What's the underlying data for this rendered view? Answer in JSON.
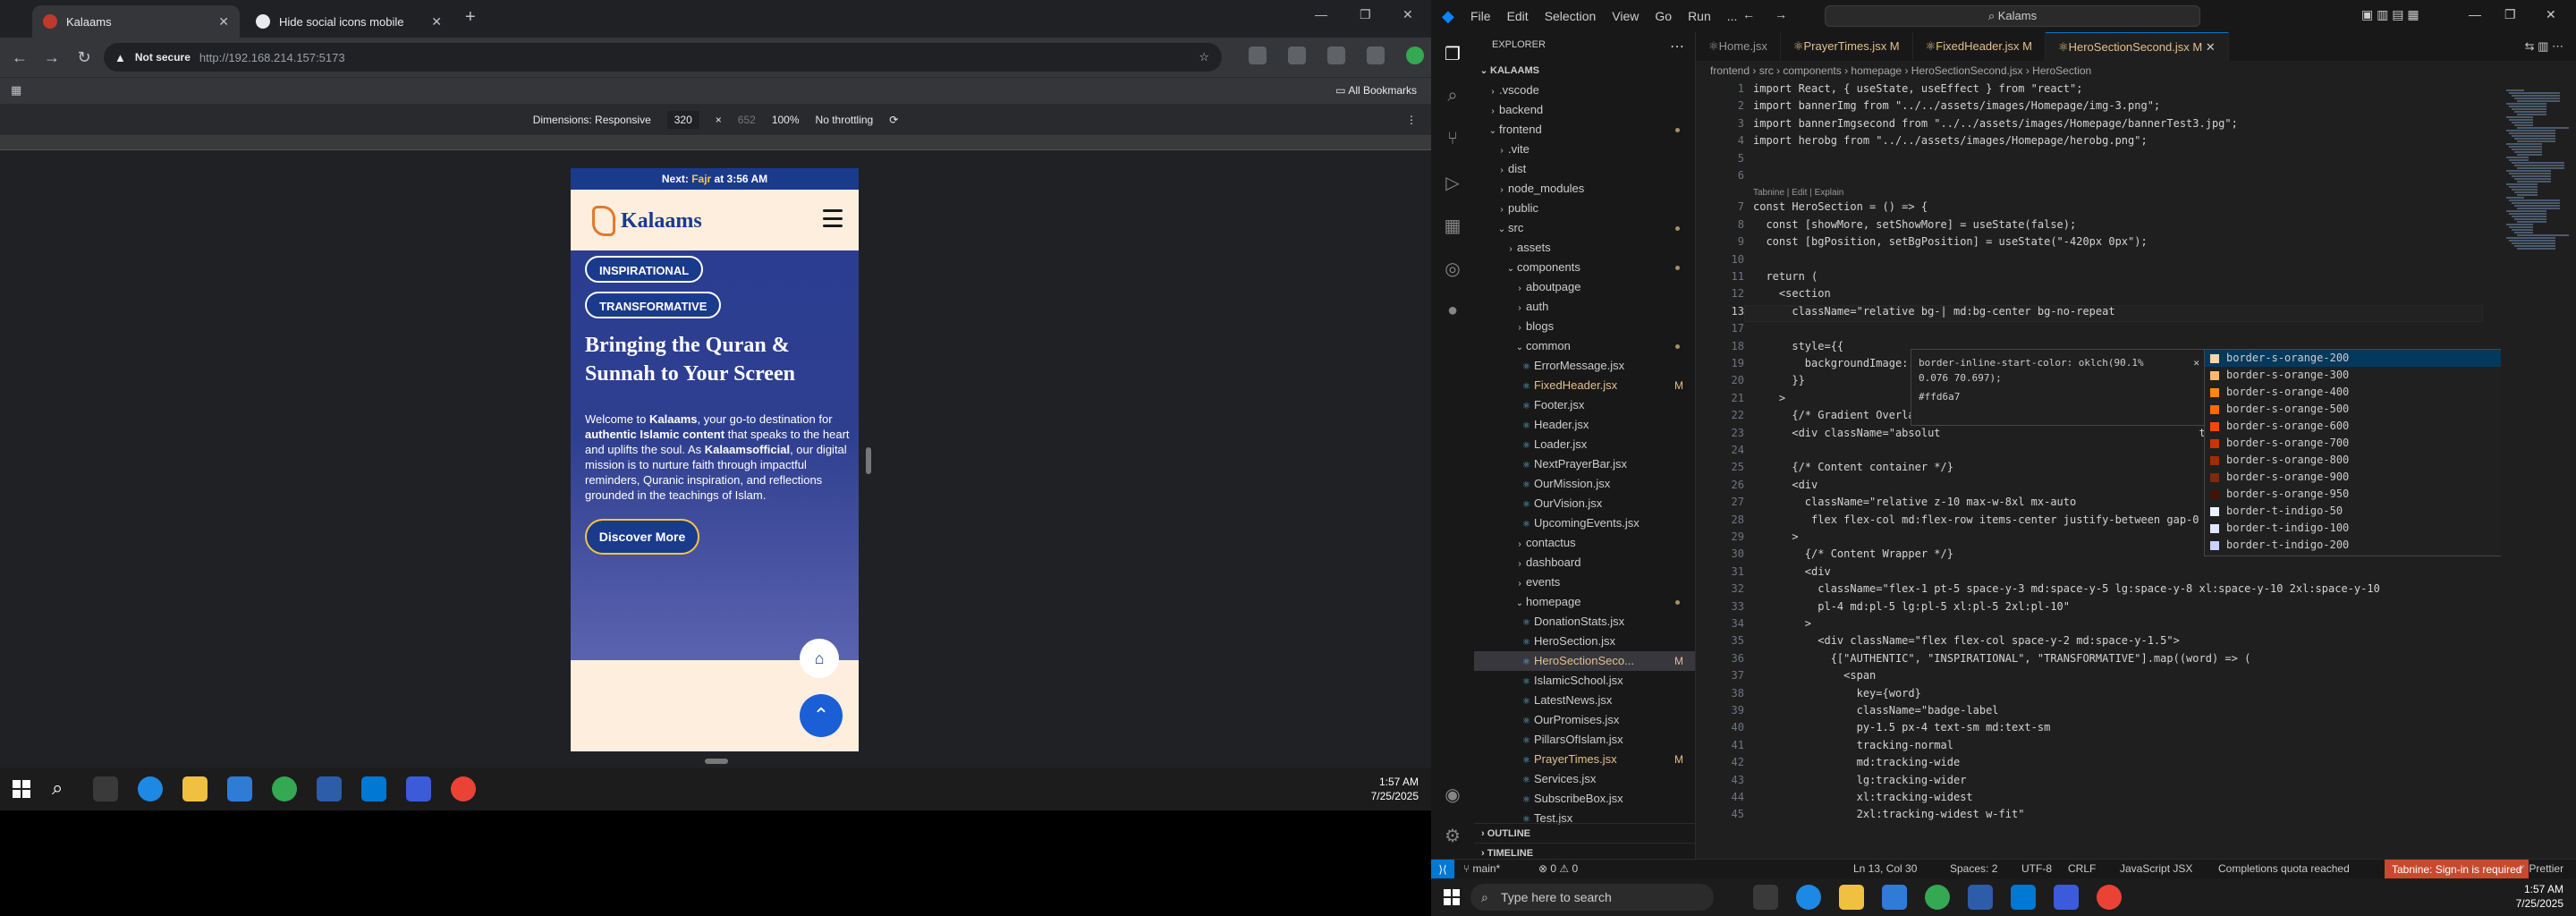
{
  "browser": {
    "tabs": [
      {
        "title": "Kalaams",
        "active": true
      },
      {
        "title": "Hide social icons mobile",
        "active": false
      }
    ],
    "not_secure": "Not secure",
    "url": "http://192.168.214.157:5173",
    "all_bookmarks": "All Bookmarks",
    "device": {
      "dimensions_label": "Dimensions: Responsive",
      "width": "320",
      "height": "652",
      "zoom": "100%",
      "throttle": "No throttling"
    }
  },
  "site": {
    "prayer_prefix": "Next: ",
    "prayer_name": "Fajr",
    "prayer_suffix": " at 3:56 AM",
    "logo": "Kalaams",
    "badges": [
      "INSPIRATIONAL",
      "TRANSFORMATIVE"
    ],
    "headline": "Bringing the Quran & Sunnah to Your Screen",
    "intro_pre": "Welcome to ",
    "intro_brand": "Kalaams",
    "intro_mid1": ", your go-to destination for ",
    "intro_strong": "authentic Islamic content",
    "intro_mid2": " that speaks to the heart and uplifts the soul. As ",
    "intro_official": "Kalaamsofficial",
    "intro_end": ", our digital mission is to nurture faith through impactful reminders, Quranic inspiration, and reflections grounded in the teachings of Islam.",
    "cta": "Discover More"
  },
  "taskbar_left": {
    "time": "1:57 AM",
    "date": "7/25/2025"
  },
  "vscode": {
    "menu": [
      "File",
      "Edit",
      "Selection",
      "View",
      "Go",
      "Run",
      "..."
    ],
    "search": "Kalams",
    "explorer_title": "EXPLORER",
    "workspace": "KALAAMS",
    "tree": [
      {
        "label": ".vscode",
        "type": "folder",
        "depth": 1,
        "open": false
      },
      {
        "label": "backend",
        "type": "folder",
        "depth": 1,
        "open": false
      },
      {
        "label": "frontend",
        "type": "folder",
        "depth": 1,
        "open": true,
        "dot": true
      },
      {
        "label": ".vite",
        "type": "folder",
        "depth": 2,
        "open": false
      },
      {
        "label": "dist",
        "type": "folder",
        "depth": 2,
        "open": false
      },
      {
        "label": "node_modules",
        "type": "folder",
        "depth": 2,
        "open": false
      },
      {
        "label": "public",
        "type": "folder",
        "depth": 2,
        "open": false
      },
      {
        "label": "src",
        "type": "folder",
        "depth": 2,
        "open": true,
        "dot": true
      },
      {
        "label": "assets",
        "type": "folder",
        "depth": 3,
        "open": false
      },
      {
        "label": "components",
        "type": "folder",
        "depth": 3,
        "open": true,
        "dot": true
      },
      {
        "label": "aboutpage",
        "type": "folder",
        "depth": 4,
        "open": false
      },
      {
        "label": "auth",
        "type": "folder",
        "depth": 4,
        "open": false
      },
      {
        "label": "blogs",
        "type": "folder",
        "depth": 4,
        "open": false
      },
      {
        "label": "common",
        "type": "folder",
        "depth": 4,
        "open": true,
        "dot": true
      },
      {
        "label": "ErrorMessage.jsx",
        "type": "file",
        "depth": 5
      },
      {
        "label": "FixedHeader.jsx",
        "type": "file",
        "depth": 5,
        "mod": "M"
      },
      {
        "label": "Footer.jsx",
        "type": "file",
        "depth": 5
      },
      {
        "label": "Header.jsx",
        "type": "file",
        "depth": 5
      },
      {
        "label": "Loader.jsx",
        "type": "file",
        "depth": 5
      },
      {
        "label": "NextPrayerBar.jsx",
        "type": "file",
        "depth": 5
      },
      {
        "label": "OurMission.jsx",
        "type": "file",
        "depth": 5
      },
      {
        "label": "OurVision.jsx",
        "type": "file",
        "depth": 5
      },
      {
        "label": "UpcomingEvents.jsx",
        "type": "file",
        "depth": 5
      },
      {
        "label": "contactus",
        "type": "folder",
        "depth": 4,
        "open": false
      },
      {
        "label": "dashboard",
        "type": "folder",
        "depth": 4,
        "open": false
      },
      {
        "label": "events",
        "type": "folder",
        "depth": 4,
        "open": false
      },
      {
        "label": "homepage",
        "type": "folder",
        "depth": 4,
        "open": true,
        "dot": true
      },
      {
        "label": "DonationStats.jsx",
        "type": "file",
        "depth": 5
      },
      {
        "label": "HeroSection.jsx",
        "type": "file",
        "depth": 5
      },
      {
        "label": "HeroSectionSeco...",
        "type": "file",
        "depth": 5,
        "mod": "M",
        "selected": true
      },
      {
        "label": "IslamicSchool.jsx",
        "type": "file",
        "depth": 5
      },
      {
        "label": "LatestNews.jsx",
        "type": "file",
        "depth": 5
      },
      {
        "label": "OurPromises.jsx",
        "type": "file",
        "depth": 5
      },
      {
        "label": "PillarsOfIslam.jsx",
        "type": "file",
        "depth": 5
      },
      {
        "label": "PrayerTimes.jsx",
        "type": "file",
        "depth": 5,
        "mod": "M"
      },
      {
        "label": "Services.jsx",
        "type": "file",
        "depth": 5
      },
      {
        "label": "SubscribeBox.jsx",
        "type": "file",
        "depth": 5
      },
      {
        "label": "Test.jsx",
        "type": "file",
        "depth": 5
      }
    ],
    "outline": "OUTLINE",
    "timeline": "TIMELINE",
    "tabs": [
      {
        "label": "Home.jsx",
        "mod": ""
      },
      {
        "label": "PrayerTimes.jsx M",
        "mod": "M"
      },
      {
        "label": "FixedHeader.jsx M",
        "mod": "M"
      },
      {
        "label": "HeroSectionSecond.jsx M",
        "mod": "M",
        "active": true
      }
    ],
    "breadcrumb": "frontend › src › components › homepage › HeroSectionSecond.jsx › HeroSection",
    "codelens": "Tabnine | Edit | Explain",
    "lines": [
      {
        "n": "1",
        "t": "import React, { useState, useEffect } from \"react\";"
      },
      {
        "n": "2",
        "t": "import bannerImg from \"../../assets/images/Homepage/img-3.png\";"
      },
      {
        "n": "3",
        "t": "import bannerImgsecond from \"../../assets/images/Homepage/bannerTest3.jpg\";"
      },
      {
        "n": "4",
        "t": "import herobg from \"../../assets/images/Homepage/herobg.png\";"
      },
      {
        "n": "5",
        "t": ""
      },
      {
        "n": "6",
        "t": ""
      },
      {
        "n": "7",
        "t": "const HeroSection = () => {"
      },
      {
        "n": "8",
        "t": "  const [showMore, setShowMore] = useState(false);"
      },
      {
        "n": "9",
        "t": "  const [bgPosition, setBgPosition] = useState(\"-420px 0px\");"
      },
      {
        "n": "10",
        "t": ""
      },
      {
        "n": "11",
        "t": "  return ("
      },
      {
        "n": "12",
        "t": "    <section"
      },
      {
        "n": "13",
        "t": "      className=\"relative bg-| md:bg-center bg-no-repeat"
      },
      {
        "n": "17",
        "t": ""
      },
      {
        "n": "18",
        "t": "      style={{"
      },
      {
        "n": "19",
        "t": "        backgroundImage: `url"
      },
      {
        "n": "20",
        "t": "      }}"
      },
      {
        "n": "21",
        "t": "    >"
      },
      {
        "n": "22",
        "t": "      {/* Gradient Overlay be"
      },
      {
        "n": "23",
        "t": "      <div className=\"absolut                                        t z-0\"></div>"
      },
      {
        "n": "24",
        "t": ""
      },
      {
        "n": "25",
        "t": "      {/* Content container */}"
      },
      {
        "n": "26",
        "t": "      <div"
      },
      {
        "n": "27",
        "t": "        className=\"relative z-10 max-w-8xl mx-auto"
      },
      {
        "n": "28",
        "t": "         flex flex-col md:flex-row items-center justify-between gap-0 pb-36 pt-7\""
      },
      {
        "n": "29",
        "t": "      >"
      },
      {
        "n": "30",
        "t": "        {/* Content Wrapper */}"
      },
      {
        "n": "31",
        "t": "        <div"
      },
      {
        "n": "32",
        "t": "          className=\"flex-1 pt-5 space-y-3 md:space-y-5 lg:space-y-8 xl:space-y-10 2xl:space-y-10"
      },
      {
        "n": "33",
        "t": "          pl-4 md:pl-5 lg:pl-5 xl:pl-5 2xl:pl-10\""
      },
      {
        "n": "34",
        "t": "        >"
      },
      {
        "n": "35",
        "t": "          <div className=\"flex flex-col space-y-2 md:space-y-1.5\">"
      },
      {
        "n": "36",
        "t": "            {[\"AUTHENTIC\", \"INSPIRATIONAL\", \"TRANSFORMATIVE\"].map((word) => ("
      },
      {
        "n": "37",
        "t": "              <span"
      },
      {
        "n": "38",
        "t": "                key={word}"
      },
      {
        "n": "39",
        "t": "                className=\"badge-label"
      },
      {
        "n": "40",
        "t": "                py-1.5 px-4 text-sm md:text-sm"
      },
      {
        "n": "41",
        "t": "                tracking-normal"
      },
      {
        "n": "42",
        "t": "                md:tracking-wide"
      },
      {
        "n": "43",
        "t": "                lg:tracking-wider"
      },
      {
        "n": "44",
        "t": "                xl:tracking-widest"
      },
      {
        "n": "45",
        "t": "                2xl:tracking-widest w-fit\""
      }
    ],
    "hover_tip": {
      "line1": "border-inline-start-color: oklch(90.1%",
      "line2": "0.076 70.697);",
      "line3": "#ffd6a7"
    },
    "suggestions": [
      {
        "label": "border-s-orange-200",
        "color": "#ffd6a7",
        "selected": true
      },
      {
        "label": "border-s-orange-300",
        "color": "#ffb86a"
      },
      {
        "label": "border-s-orange-400",
        "color": "#ff8904"
      },
      {
        "label": "border-s-orange-500",
        "color": "#ff6900"
      },
      {
        "label": "border-s-orange-600",
        "color": "#f54900"
      },
      {
        "label": "border-s-orange-700",
        "color": "#ca3500"
      },
      {
        "label": "border-s-orange-800",
        "color": "#9f2d00"
      },
      {
        "label": "border-s-orange-900",
        "color": "#7e2a0c"
      },
      {
        "label": "border-s-orange-950",
        "color": "#441306"
      },
      {
        "label": "border-t-indigo-50",
        "color": "#eef2ff"
      },
      {
        "label": "border-t-indigo-100",
        "color": "#e0e7ff"
      },
      {
        "label": "border-t-indigo-200",
        "color": "#c6d2ff"
      }
    ],
    "status": {
      "branch": "main*",
      "problems": "⊗ 0 ⚠ 0",
      "position": "Ln 13, Col 30",
      "spaces": "Spaces: 2",
      "encoding": "UTF-8",
      "eol": "CRLF",
      "language": "JavaScript JSX",
      "quota": "Completions quota reached",
      "tabnine": "Tabnine: Sign-in is required",
      "prettier": "✓ Prettier"
    }
  },
  "taskbar_right": {
    "search_placeholder": "Type here to search",
    "time": "1:57 AM",
    "date": "7/25/2025"
  }
}
